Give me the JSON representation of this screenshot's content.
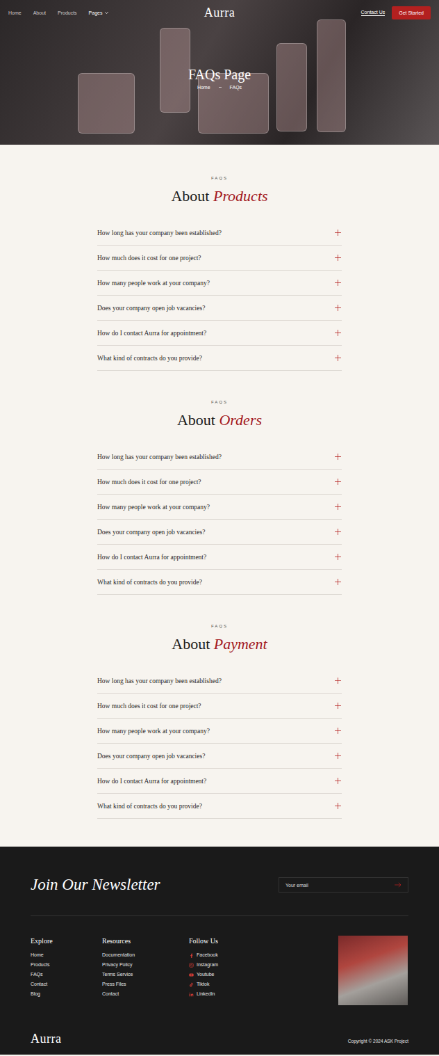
{
  "nav": {
    "links": [
      {
        "label": "Home",
        "selected": false
      },
      {
        "label": "About",
        "selected": false
      },
      {
        "label": "Products",
        "selected": false
      },
      {
        "label": "Pages",
        "selected": true,
        "dropdown": true
      }
    ],
    "logo": "Aurra",
    "contact": "Contact Us",
    "cta": "Get Started"
  },
  "hero": {
    "title": "FAQs Page",
    "breadcrumb": [
      "Home",
      "FAQs"
    ]
  },
  "sections": [
    {
      "label": "FAQS",
      "title": "About",
      "accent": "Products",
      "items": [
        {
          "question": "How long has your company been established?",
          "expanded": false
        },
        {
          "question": "How much does it cost for one project?",
          "expanded": false
        },
        {
          "question": "How many people work at your company?",
          "expanded": false
        },
        {
          "question": "Does your company open job vacancies?",
          "expanded": false
        },
        {
          "question": "How do I contact Aurra for appointment?",
          "expanded": false
        },
        {
          "question": "What kind of contracts do you provide?",
          "expanded": false
        }
      ]
    },
    {
      "label": "FAQS",
      "title": "About",
      "accent": "Orders",
      "items": [
        {
          "question": "How long has your company been established?",
          "expanded": false
        },
        {
          "question": "How much does it cost for one project?",
          "expanded": false
        },
        {
          "question": "How many people work at your company?",
          "expanded": false
        },
        {
          "question": "Does your company open job vacancies?",
          "expanded": false
        },
        {
          "question": "How do I contact Aurra for appointment?",
          "expanded": false
        },
        {
          "question": "What kind of contracts do you provide?",
          "expanded": false
        }
      ]
    },
    {
      "label": "FAQS",
      "title": "About",
      "accent": "Payment",
      "items": [
        {
          "question": "How long has your company been established?",
          "expanded": false
        },
        {
          "question": "How much does it cost for one project?",
          "expanded": false
        },
        {
          "question": "How many people work at your company?",
          "expanded": false
        },
        {
          "question": "Does your company open job vacancies?",
          "expanded": false
        },
        {
          "question": "How do I contact Aurra for appointment?",
          "expanded": false
        },
        {
          "question": "What kind of contracts do you provide?",
          "expanded": false
        }
      ]
    }
  ],
  "footer": {
    "newsletter": {
      "title": "Join Our Newsletter",
      "placeholder": "Your email"
    },
    "columns": [
      {
        "title": "Explore",
        "links": [
          {
            "label": "Home"
          },
          {
            "label": "Products"
          },
          {
            "label": "FAQs"
          },
          {
            "label": "Contact"
          },
          {
            "label": "Blog"
          }
        ]
      },
      {
        "title": "Resources",
        "links": [
          {
            "label": "Documentation"
          },
          {
            "label": "Privacy Policy"
          },
          {
            "label": "Terms Service"
          },
          {
            "label": "Press Files"
          },
          {
            "label": "Contact"
          }
        ]
      },
      {
        "title": "Follow Us",
        "links": [
          {
            "label": "Facebook",
            "icon": "facebook"
          },
          {
            "label": "Instagram",
            "icon": "instagram"
          },
          {
            "label": "Youtube",
            "icon": "youtube"
          },
          {
            "label": "Tiktok",
            "icon": "tiktok"
          },
          {
            "label": "LinkedIn",
            "icon": "linkedin"
          }
        ]
      }
    ],
    "logo": "Aurra",
    "copyright": "Copyright © 2024 ASK Project"
  }
}
